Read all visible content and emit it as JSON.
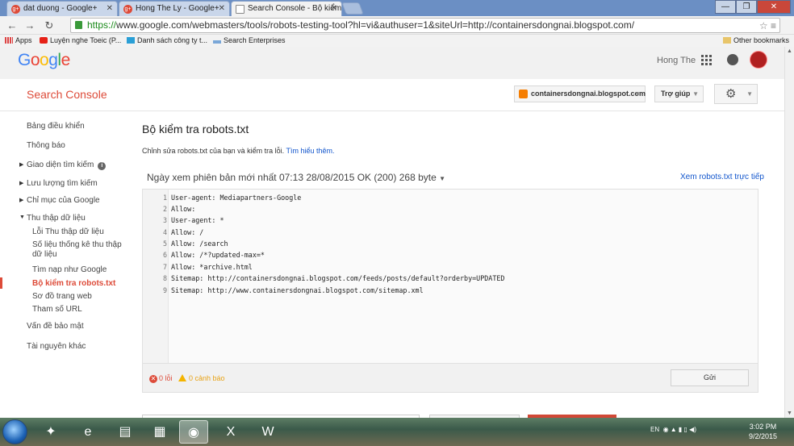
{
  "browser": {
    "tabs": [
      {
        "title": "dat duong - Google+",
        "icon": "google-plus-icon",
        "active": false
      },
      {
        "title": "Hong The Ly - Google+",
        "icon": "google-plus-icon",
        "active": false
      },
      {
        "title": "Search Console - Bộ kiểm",
        "icon": "document-icon",
        "active": true
      }
    ],
    "url_scheme": "https://",
    "url_rest": "www.google.com/webmasters/tools/robots-testing-tool?hl=vi&authuser=1&siteUrl=http://containersdongnai.blogspot.com/",
    "bookmarks": [
      {
        "label": "Apps",
        "icon": "apps-grid-icon"
      },
      {
        "label": "Luyện nghe Toeic (P...",
        "icon": "youtube-icon"
      },
      {
        "label": "Danh sách công ty t...",
        "icon": "sheet-icon"
      },
      {
        "label": "Search Enterprises",
        "icon": "site-icon"
      }
    ],
    "other_bookmarks": "Other bookmarks"
  },
  "header": {
    "logo": "Google",
    "user_name": "Hong The"
  },
  "console": {
    "title": "Search Console",
    "site": "containersdongnai.blogspot.com",
    "help": "Trợ giúp"
  },
  "sidebar": {
    "items": [
      {
        "label": "Bảng điều khiển"
      },
      {
        "label": "Thông báo"
      },
      {
        "label": "Giao diện tìm kiếm"
      },
      {
        "label": "Lưu lượng tìm kiếm"
      },
      {
        "label": "Chỉ mục của Google"
      },
      {
        "label": "Thu thập dữ liệu"
      },
      {
        "label": "Vấn đề bảo mật"
      },
      {
        "label": "Tài nguyên khác"
      }
    ],
    "subitems": [
      {
        "label": "Lỗi Thu thập dữ liệu"
      },
      {
        "label": "Số liệu thống kê thu thập dữ liệu"
      },
      {
        "label": "Tìm nạp như Google"
      },
      {
        "label": "Bộ kiểm tra robots.txt",
        "active": true
      },
      {
        "label": "Sơ đồ trang web"
      },
      {
        "label": "Tham số URL"
      }
    ]
  },
  "main": {
    "title": "Bộ kiểm tra robots.txt",
    "description": "Chỉnh sửa robots.txt của bạn và kiểm tra lỗi.",
    "learn_more": "Tìm hiểu thêm.",
    "version": "Ngày xem phiên bản mới nhất 07:13 28/08/2015 OK (200) 268 byte",
    "live_link": "Xem robots.txt trực tiếp",
    "lines": [
      {
        "num": "1",
        "text": "User-agent: Mediapartners-Google"
      },
      {
        "num": "2",
        "text": "Allow:"
      },
      {
        "num": "3",
        "text": "User-agent: *"
      },
      {
        "num": "4",
        "text": "Allow: /"
      },
      {
        "num": "5",
        "text": "Allow: /search"
      },
      {
        "num": "6",
        "text": "Allow: /*?updated-max=*"
      },
      {
        "num": "7",
        "text": "Allow: *archive.html"
      },
      {
        "num": "8",
        "text": "Sitemap: http://containersdongnai.blogspot.com/feeds/posts/default?orderby=UPDATED"
      },
      {
        "num": "9",
        "text": "Sitemap: http://www.containersdongnai.blogspot.com/sitemap.xml"
      }
    ],
    "errors": "0 lỗi",
    "warnings": "0 cảnh báo",
    "submit": "Gửi"
  },
  "taskbar": {
    "language": "EN",
    "time": "3:02 PM",
    "date": "9/2/2015"
  },
  "colors": {
    "accent_red": "#dd4b39",
    "link_blue": "#1155cc",
    "warning_yellow": "#f4b400"
  }
}
